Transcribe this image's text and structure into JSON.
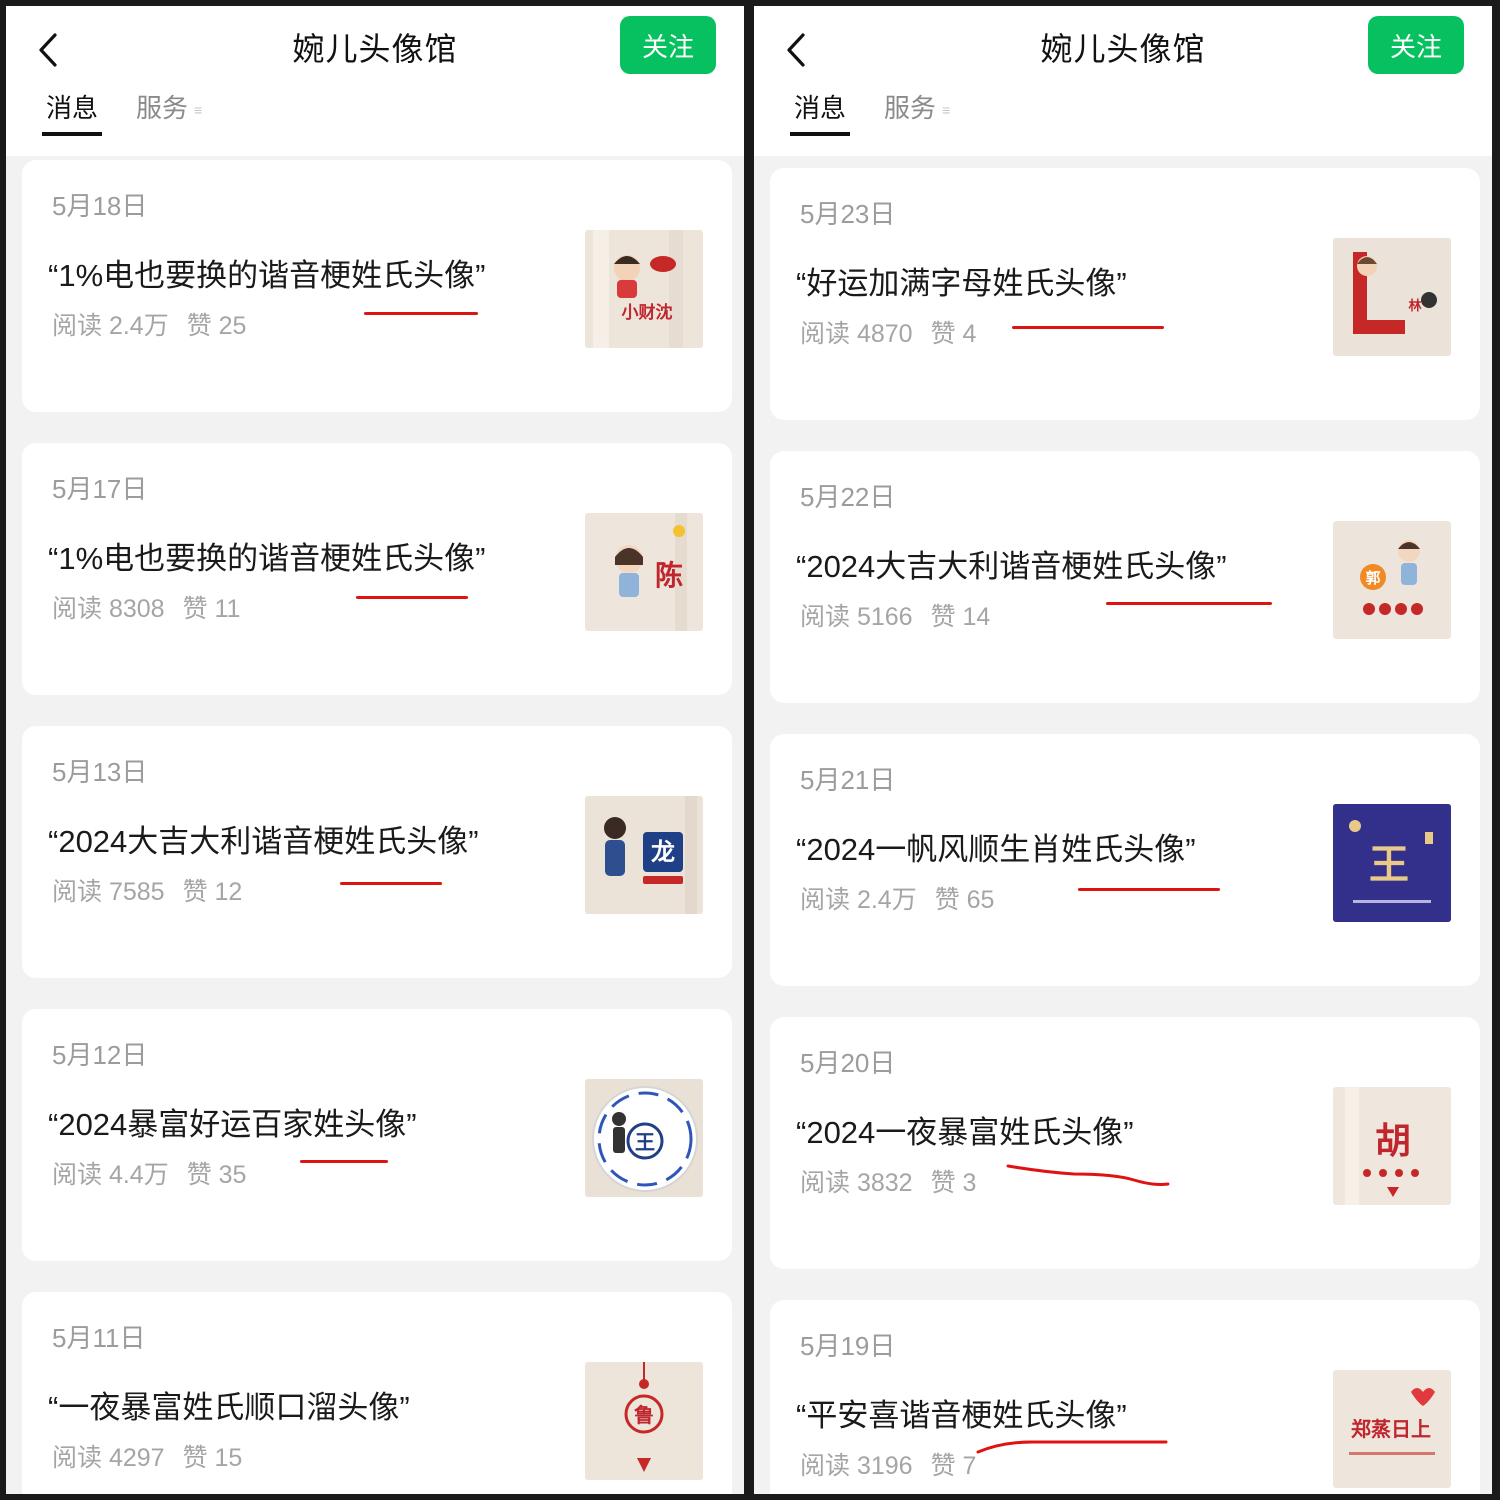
{
  "left": {
    "title": "婉儿头像馆",
    "follow_label": "关注",
    "tabs": {
      "messages": "消息",
      "services": "服务"
    },
    "articles": [
      {
        "date": "5月18日",
        "title": "“1%电也要换的谐音梗姓氏头像”",
        "reads": "阅读 2.4万",
        "likes": "赞 25",
        "thumb_text": "小财沈"
      },
      {
        "date": "5月17日",
        "title": "“1%电也要换的谐音梗姓氏头像”",
        "reads": "阅读 8308",
        "likes": "赞 11",
        "thumb_text": "陈"
      },
      {
        "date": "5月13日",
        "title": "“2024大吉大利谐音梗姓氏头像”",
        "reads": "阅读 7585",
        "likes": "赞 12",
        "thumb_text": "龙"
      },
      {
        "date": "5月12日",
        "title": "“2024暴富好运百家姓头像”",
        "reads": "阅读 4.4万",
        "likes": "赞 35",
        "thumb_text": "王"
      },
      {
        "date": "5月11日",
        "title": "“一夜暴富姓氏顺口溜头像”",
        "reads": "阅读 4297",
        "likes": "赞 15",
        "thumb_text": "鲁"
      }
    ]
  },
  "right": {
    "title": "婉儿头像馆",
    "follow_label": "关注",
    "tabs": {
      "messages": "消息",
      "services": "服务"
    },
    "articles": [
      {
        "date": "5月23日",
        "title": "“好运加满字母姓氏头像”",
        "reads": "阅读 4870",
        "likes": "赞 4",
        "thumb_text": "林"
      },
      {
        "date": "5月22日",
        "title": "“2024大吉大利谐音梗姓氏头像”",
        "reads": "阅读 5166",
        "likes": "赞 14",
        "thumb_text": "郭"
      },
      {
        "date": "5月21日",
        "title": "“2024一帆风顺生肖姓氏头像”",
        "reads": "阅读 2.4万",
        "likes": "赞 65",
        "thumb_text": "王"
      },
      {
        "date": "5月20日",
        "title": "“2024一夜暴富姓氏头像”",
        "reads": "阅读 3832",
        "likes": "赞 3",
        "thumb_text": "胡"
      },
      {
        "date": "5月19日",
        "title": "“平安喜谐音梗姓氏头像”",
        "reads": "阅读 3196",
        "likes": "赞 7",
        "thumb_text": "郑蒸日上"
      }
    ]
  },
  "colors": {
    "accent_green": "#07c160",
    "annotation_red": "#e01313",
    "page_bg": "#f2f2f2",
    "card_bg": "#ffffff"
  },
  "icons": {
    "back": "chevron-left-icon",
    "menu": "menu-lines-icon"
  }
}
